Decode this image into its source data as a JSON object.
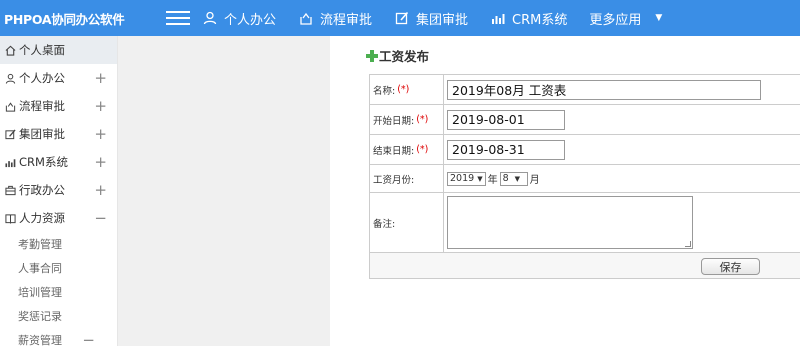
{
  "app": {
    "title": "PHPOA协同办公软件"
  },
  "topnav": [
    {
      "label": "个人办公",
      "icon": "user-icon"
    },
    {
      "label": "流程审批",
      "icon": "flow-icon"
    },
    {
      "label": "集团审批",
      "icon": "edit-icon"
    },
    {
      "label": "CRM系统",
      "icon": "bar-chart-icon"
    },
    {
      "label": "更多应用",
      "icon": "caret-down-icon"
    }
  ],
  "sidebar": {
    "items": [
      {
        "label": "个人桌面",
        "icon": "home-icon",
        "toggle": ""
      },
      {
        "label": "个人办公",
        "icon": "user-icon",
        "toggle": "+"
      },
      {
        "label": "流程审批",
        "icon": "flow-icon",
        "toggle": "+"
      },
      {
        "label": "集团审批",
        "icon": "edit-icon",
        "toggle": "+"
      },
      {
        "label": "CRM系统",
        "icon": "bar-chart-icon",
        "toggle": "+"
      },
      {
        "label": "行政办公",
        "icon": "briefcase-icon",
        "toggle": "+"
      },
      {
        "label": "人力资源",
        "icon": "book-icon",
        "toggle": "−"
      }
    ],
    "subitems": [
      {
        "label": "考勤管理",
        "toggle": ""
      },
      {
        "label": "人事合同",
        "toggle": ""
      },
      {
        "label": "培训管理",
        "toggle": ""
      },
      {
        "label": "奖惩记录",
        "toggle": ""
      },
      {
        "label": "薪资管理",
        "toggle": "−"
      }
    ]
  },
  "page": {
    "title": "工资发布"
  },
  "form": {
    "required_mark": "(*)",
    "name": {
      "label": "名称:",
      "value": "2019年08月 工资表"
    },
    "start_date": {
      "label": "开始日期:",
      "value": "2019-08-01"
    },
    "end_date": {
      "label": "结束日期:",
      "value": "2019-08-31"
    },
    "month": {
      "label": "工资月份:",
      "year": "2019",
      "year_unit": "年",
      "month": "8",
      "month_unit": "月"
    },
    "remark": {
      "label": "备注:",
      "value": ""
    },
    "save_label": "保存"
  }
}
